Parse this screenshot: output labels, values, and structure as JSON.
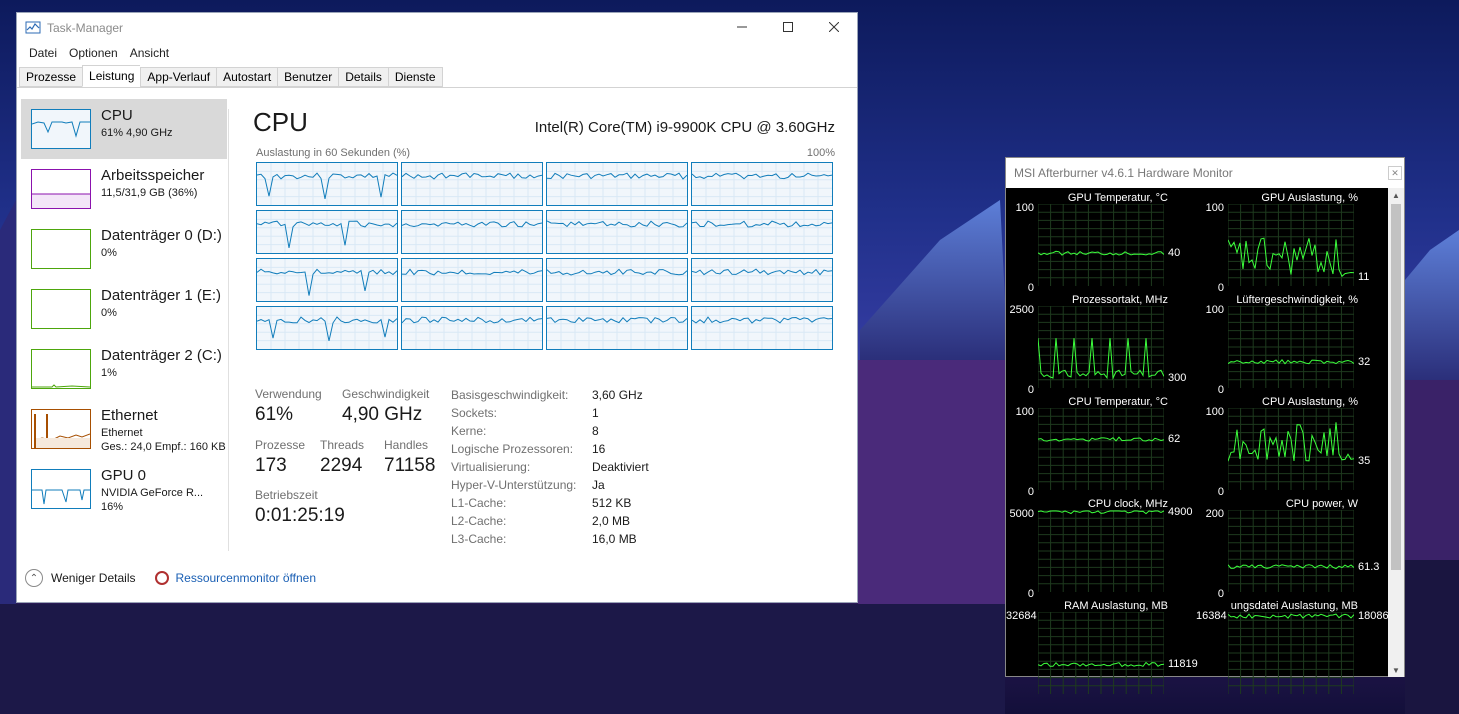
{
  "taskmanager": {
    "title": "Task-Manager",
    "menu": [
      "Datei",
      "Optionen",
      "Ansicht"
    ],
    "tabs": [
      "Prozesse",
      "Leistung",
      "App-Verlauf",
      "Autostart",
      "Benutzer",
      "Details",
      "Dienste"
    ],
    "active_tab": "Leistung",
    "sidebar": [
      {
        "name": "CPU",
        "sub": "61% 4,90 GHz",
        "sub2": "",
        "color": "#117dbb"
      },
      {
        "name": "Arbeitsspeicher",
        "sub": "11,5/31,9 GB (36%)",
        "sub2": "",
        "color": "#8b12ae"
      },
      {
        "name": "Datenträger 0 (D:)",
        "sub": "0%",
        "sub2": "",
        "color": "#4da60c"
      },
      {
        "name": "Datenträger 1 (E:)",
        "sub": "0%",
        "sub2": "",
        "color": "#4da60c"
      },
      {
        "name": "Datenträger 2 (C:)",
        "sub": "1%",
        "sub2": "",
        "color": "#4da60c"
      },
      {
        "name": "Ethernet",
        "sub": "Ethernet",
        "sub2": "Ges.: 24,0 Empf.: 160 KB",
        "color": "#a74f01"
      },
      {
        "name": "GPU 0",
        "sub": "NVIDIA GeForce R...",
        "sub2": "16%",
        "color": "#117dbb"
      }
    ],
    "main": {
      "title": "CPU",
      "model": "Intel(R) Core(TM) i9-9900K CPU @ 3.60GHz",
      "graph_left_label": "Auslastung in 60 Sekunden (%)",
      "graph_right_label": "100%",
      "stats": {
        "verwendung_label": "Verwendung",
        "verwendung": "61%",
        "geschw_label": "Geschwindigkeit",
        "geschw": "4,90 GHz",
        "prozesse_label": "Prozesse",
        "prozesse": "173",
        "threads_label": "Threads",
        "threads": "2294",
        "handles_label": "Handles",
        "handles": "71158",
        "betrieb_label": "Betriebszeit",
        "betrieb": "0:01:25:19"
      },
      "specs": [
        {
          "k": "Basisgeschwindigkeit:",
          "v": "3,60 GHz"
        },
        {
          "k": "Sockets:",
          "v": "1"
        },
        {
          "k": "Kerne:",
          "v": "8"
        },
        {
          "k": "Logische Prozessoren:",
          "v": "16"
        },
        {
          "k": "Virtualisierung:",
          "v": "Deaktiviert"
        },
        {
          "k": "Hyper-V-Unterstützung:",
          "v": "Ja"
        },
        {
          "k": "L1-Cache:",
          "v": "512 KB"
        },
        {
          "k": "L2-Cache:",
          "v": "2,0 MB"
        },
        {
          "k": "L3-Cache:",
          "v": "16,0 MB"
        }
      ]
    },
    "footer": {
      "less": "Weniger Details",
      "resmon": "Ressourcenmonitor öffnen"
    }
  },
  "afterburner": {
    "title": "MSI Afterburner v4.6.1 Hardware Monitor",
    "panels": [
      {
        "title": "GPU Temperatur, °C",
        "max": "100",
        "min": "0",
        "cur": "40",
        "cur_frac": 0.4
      },
      {
        "title": "GPU Auslastung, %",
        "max": "100",
        "min": "0",
        "cur": "11",
        "cur_frac": 0.11
      },
      {
        "title": "Prozessortakt, MHz",
        "max": "2500",
        "min": "0",
        "cur": "300",
        "cur_frac": 0.12
      },
      {
        "title": "Lüftergeschwindigkeit, %",
        "max": "100",
        "min": "0",
        "cur": "32",
        "cur_frac": 0.32
      },
      {
        "title": "CPU Temperatur, °C",
        "max": "100",
        "min": "0",
        "cur": "62",
        "cur_frac": 0.62
      },
      {
        "title": "CPU Auslastung, %",
        "max": "100",
        "min": "0",
        "cur": "35",
        "cur_frac": 0.35
      },
      {
        "title": "CPU clock, MHz",
        "max": "5000",
        "min": "0",
        "cur": "4900",
        "cur_frac": 0.98
      },
      {
        "title": "CPU power, W",
        "max": "200",
        "min": "0",
        "cur": "61.3",
        "cur_frac": 0.31
      },
      {
        "title": "RAM Auslastung, MB",
        "max": "32684",
        "min": "",
        "cur": "11819",
        "cur_frac": 0.36
      },
      {
        "title": "ungsdatei Auslastung, MB",
        "max": "16384",
        "min": "",
        "cur": "18086",
        "cur_frac": 0.95
      }
    ]
  }
}
